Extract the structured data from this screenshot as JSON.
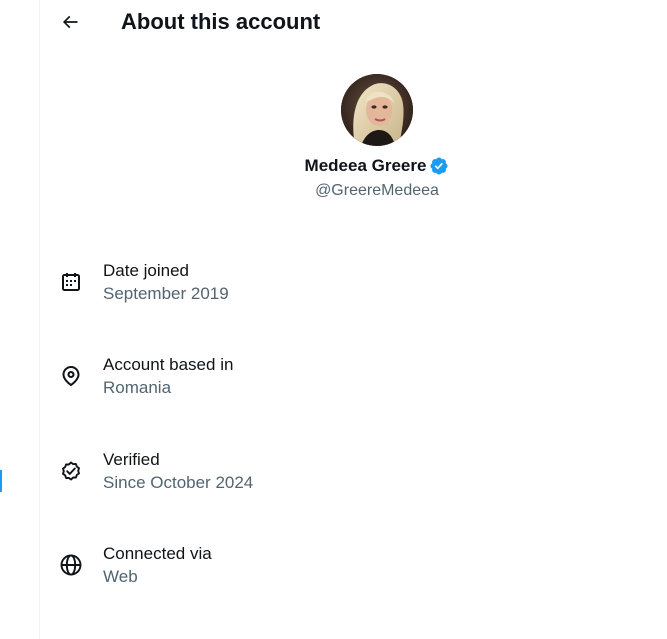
{
  "header": {
    "title": "About this account"
  },
  "profile": {
    "display_name": "Medeea Greere",
    "handle": "@GreereMedeea",
    "verified_badge_color": "#1d9bf0"
  },
  "info": [
    {
      "icon": "calendar-icon",
      "label": "Date joined",
      "value": "September 2019"
    },
    {
      "icon": "location-pin-icon",
      "label": "Account based in",
      "value": "Romania"
    },
    {
      "icon": "verified-badge-outline-icon",
      "label": "Verified",
      "value": "Since October 2024"
    },
    {
      "icon": "globe-icon",
      "label": "Connected via",
      "value": "Web"
    }
  ],
  "colors": {
    "text_primary": "#0f1419",
    "text_secondary": "#536471",
    "accent": "#1d9bf0"
  }
}
